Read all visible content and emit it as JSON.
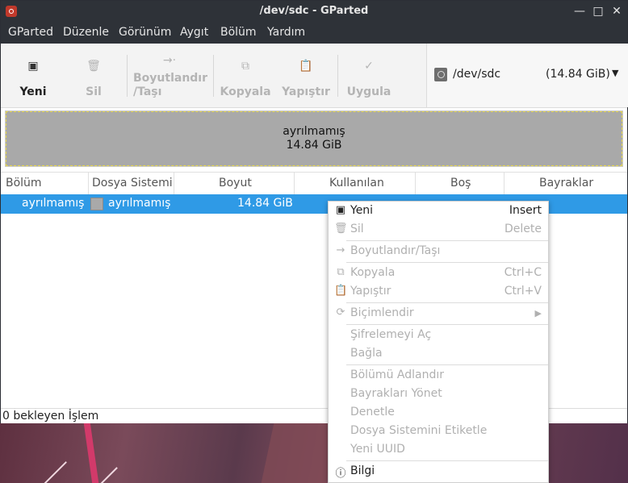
{
  "window": {
    "title": "/dev/sdc - GParted"
  },
  "menubar": {
    "items": [
      "GParted",
      "Düzenle",
      "Görünüm",
      "Aygıt",
      "Bölüm",
      "Yardım"
    ]
  },
  "toolbar": {
    "new": {
      "label": "Yeni",
      "icon": "new-partition-icon"
    },
    "delete": {
      "label": "Sil",
      "icon": "trash-icon"
    },
    "resize": {
      "label_line1": "Boyutlandır",
      "label_line2": "/Taşı",
      "icon": "resize-move-icon"
    },
    "copy": {
      "label": "Kopyala",
      "icon": "copy-icon"
    },
    "paste": {
      "label": "Yapıştır",
      "icon": "paste-icon"
    },
    "apply": {
      "label": "Uygula",
      "icon": "checkmark-icon"
    }
  },
  "device": {
    "name": "/dev/sdc",
    "size": "(14.84 GiB)"
  },
  "disk_map": {
    "label": "ayrılmamış",
    "size": "14.84 GiB"
  },
  "table": {
    "headers": [
      "Bölüm",
      "Dosya Sistemi",
      "Boyut",
      "Kullanılan",
      "Boş",
      "Bayraklar"
    ],
    "rows": [
      {
        "partition": "ayrılmamış",
        "filesystem": "ayrılmamış",
        "size": "14.84 GiB",
        "used": "",
        "free": "",
        "flags": ""
      }
    ]
  },
  "status": {
    "text": "0 bekleyen İşlem"
  },
  "context_menu": {
    "items": [
      {
        "label": "Yeni",
        "shortcut": "Insert",
        "enabled": true,
        "icon": "new-partition-icon"
      },
      {
        "label": "Sil",
        "shortcut": "Delete",
        "enabled": false,
        "icon": "trash-icon"
      },
      {
        "label": "Boyutlandır/Taşı",
        "shortcut": "",
        "enabled": false,
        "icon": "resize-move-icon"
      },
      {
        "label": "Kopyala",
        "shortcut": "Ctrl+C",
        "enabled": false,
        "icon": "copy-icon"
      },
      {
        "label": "Yapıştır",
        "shortcut": "Ctrl+V",
        "enabled": false,
        "icon": "paste-icon"
      },
      {
        "label": "Biçimlendir",
        "shortcut": "",
        "enabled": false,
        "icon": "format-icon",
        "submenu": true
      },
      {
        "label": "Şifrelemeyi Aç",
        "shortcut": "",
        "enabled": false
      },
      {
        "label": "Bağla",
        "shortcut": "",
        "enabled": false
      },
      {
        "label": "Bölümü Adlandır",
        "shortcut": "",
        "enabled": false
      },
      {
        "label": "Bayrakları Yönet",
        "shortcut": "",
        "enabled": false
      },
      {
        "label": "Denetle",
        "shortcut": "",
        "enabled": false
      },
      {
        "label": "Dosya Sistemini Etiketle",
        "shortcut": "",
        "enabled": false
      },
      {
        "label": "Yeni UUID",
        "shortcut": "",
        "enabled": false
      },
      {
        "label": "Bilgi",
        "shortcut": "",
        "enabled": true,
        "icon": "info-icon"
      }
    ]
  },
  "colors": {
    "selection": "#2f9ae6",
    "unallocated": "#a9a9a9",
    "titlebar": "#2e3238"
  }
}
